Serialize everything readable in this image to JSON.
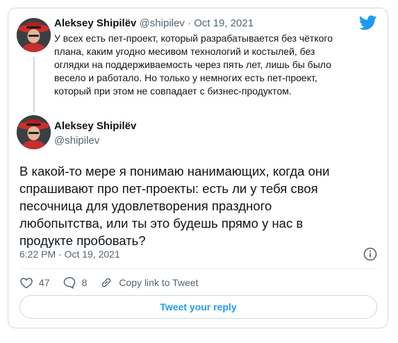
{
  "colors": {
    "accent": "#1d9bf0",
    "muted": "#536471",
    "text": "#0f1419",
    "border": "#cfd9de"
  },
  "parent_tweet": {
    "author_name": "Aleksey Shipilëv",
    "handle": "@shipilev",
    "separator": "·",
    "date": "Oct 19, 2021",
    "lines": [
      "У всех есть пет-проект, который разрабатывается без чёткого",
      "плана, каким угодно месивом технологий и костылей, без",
      "оглядки на поддерживаемость через пять лет, лишь бы было",
      "весело и работало. Но только у немногих есть пет-проект,",
      "который при этом не совпадает с бизнес-продуктом."
    ],
    "avatar_icon": "profile-photo"
  },
  "main_tweet": {
    "author_name": "Aleksey Shipilëv",
    "handle": "@shipilev",
    "lines": [
      "В какой-то мере я понимаю нанимающих, когда они",
      "спрашивают про пет-проекты: есть ли у тебя своя",
      "песочница для удовлетворения праздного",
      "любопытства, или ты это будешь прямо у нас в",
      "продукте пробовать?"
    ],
    "timestamp": "6:22 PM · Oct 19, 2021",
    "info_icon": "info-icon"
  },
  "actions": {
    "likes": "47",
    "replies": "8",
    "copy_link_label": "Copy link to Tweet"
  },
  "reply_button_label": "Tweet your reply",
  "logo_icon": "twitter-bird-icon"
}
